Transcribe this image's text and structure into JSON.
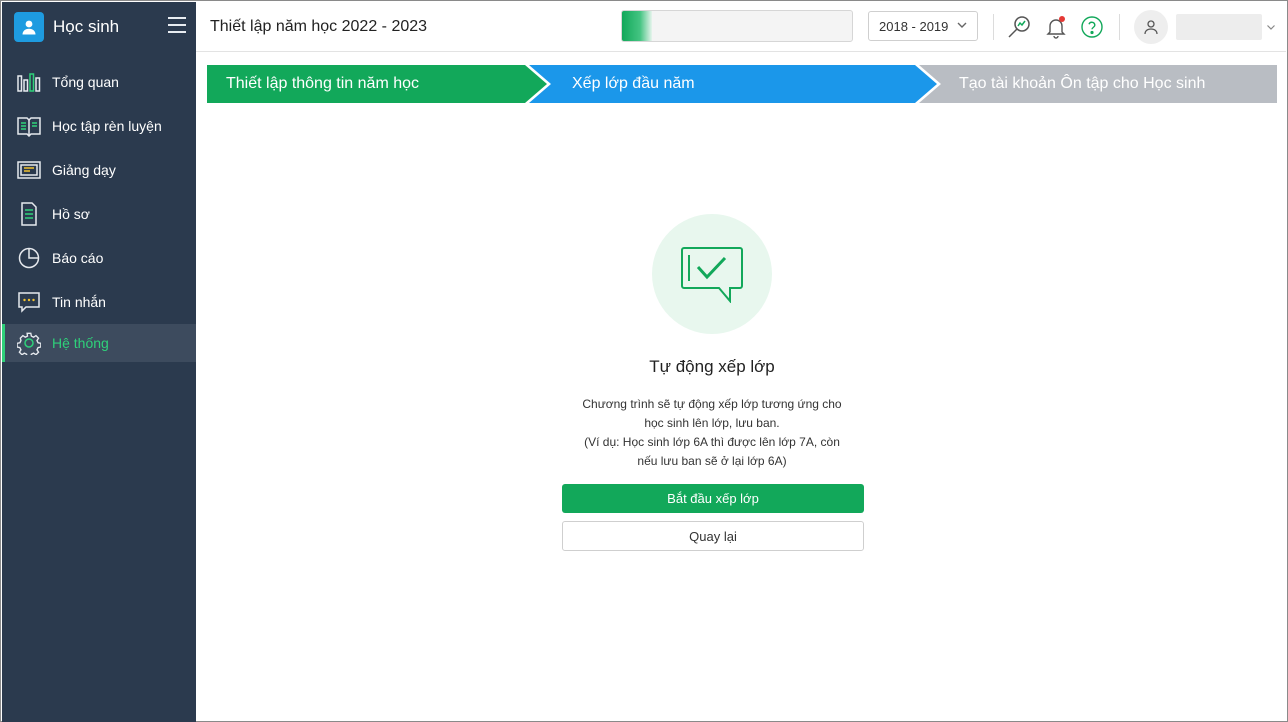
{
  "app": {
    "title": "Học sinh"
  },
  "sidebar": {
    "items": [
      {
        "label": "Tổng quan",
        "icon": "bar-chart-icon"
      },
      {
        "label": "Học tập rèn luyện",
        "icon": "book-icon"
      },
      {
        "label": "Giảng dạy",
        "icon": "board-icon"
      },
      {
        "label": "Hồ sơ",
        "icon": "document-icon"
      },
      {
        "label": "Báo cáo",
        "icon": "pie-chart-icon"
      },
      {
        "label": "Tin nhắn",
        "icon": "message-icon"
      },
      {
        "label": "Hệ thống",
        "icon": "gear-icon",
        "active": true
      }
    ]
  },
  "header": {
    "page_title": "Thiết lập năm học 2022 - 2023",
    "progress_fraction": 0.13,
    "school_year": "2018 - 2019"
  },
  "stepper": {
    "steps": [
      {
        "label": "Thiết lập thông tin năm học",
        "state": "done"
      },
      {
        "label": "Xếp lớp đầu năm",
        "state": "current"
      },
      {
        "label": "Tạo tài khoản Ôn tập cho Học sinh",
        "state": "pending"
      }
    ]
  },
  "content": {
    "title": "Tự động xếp lớp",
    "desc_line1": "Chương trình sẽ tự động xếp lớp tương ứng cho",
    "desc_line2": "học sinh lên lớp, lưu ban.",
    "desc_line3": "(Ví dụ: Học sinh lớp 6A thì được lên lớp 7A, còn",
    "desc_line4": "nếu lưu ban sẽ ở lại lớp 6A)",
    "primary_button": "Bắt đầu xếp lớp",
    "secondary_button": "Quay lại"
  },
  "colors": {
    "sidebar_bg": "#2b3a4e",
    "accent_green": "#12a85a",
    "accent_blue": "#1b97ea",
    "step_pending": "#b9bdc3",
    "active_text": "#2fd17a"
  }
}
